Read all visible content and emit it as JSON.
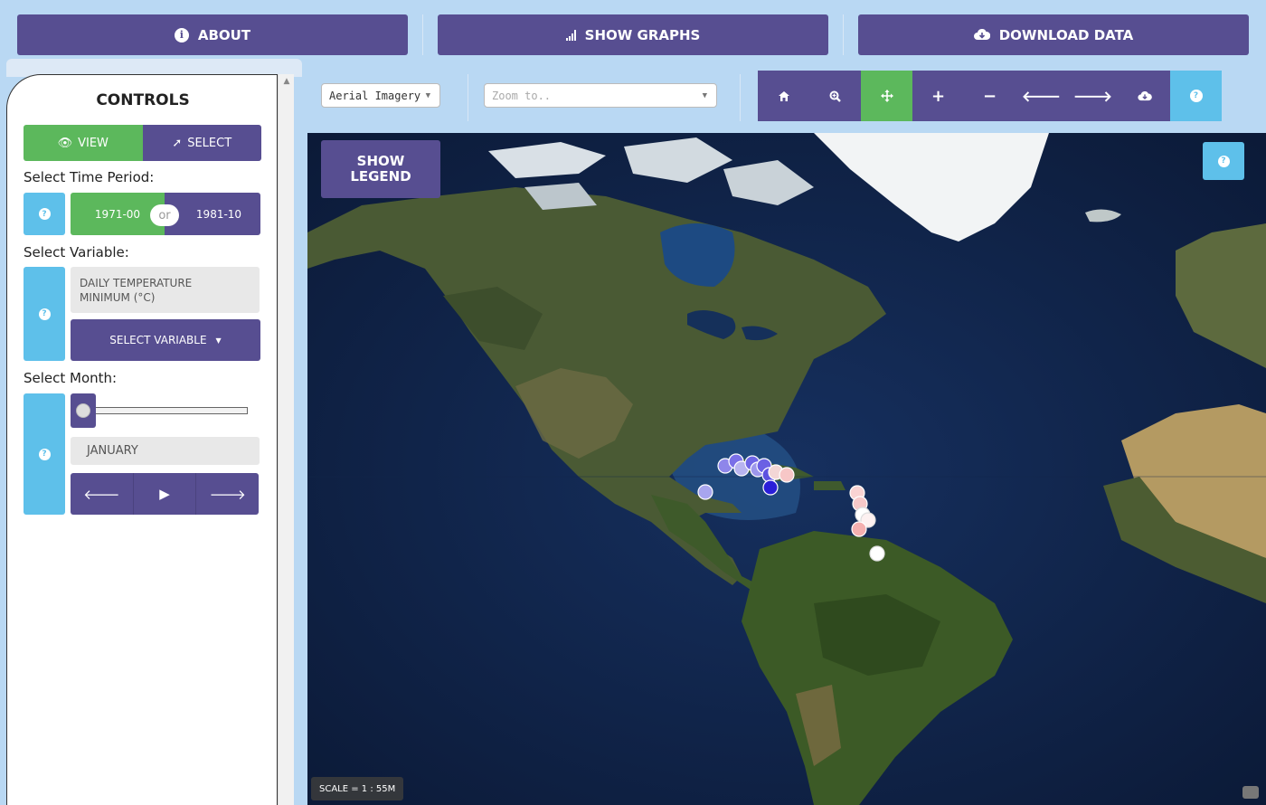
{
  "topbar": {
    "about_label": "ABOUT",
    "graphs_label": "SHOW GRAPHS",
    "download_label": "DOWNLOAD DATA"
  },
  "controls": {
    "title": "CONTROLS",
    "mode": {
      "view_label": "VIEW",
      "select_label": "SELECT",
      "active": "view"
    },
    "time_period": {
      "label": "Select Time Period:",
      "option_a": "1971-00",
      "or_text": "or",
      "option_b": "1981-10",
      "active": "1971-00"
    },
    "variable": {
      "label": "Select Variable:",
      "current_line1": "DAILY TEMPERATURE",
      "current_line2": "MINIMUM (°C)",
      "button_label": "SELECT VARIABLE"
    },
    "month": {
      "label": "Select Month:",
      "current": "JANUARY",
      "slider_value": 0
    }
  },
  "map_toolbar": {
    "basemap": "Aerial Imagery",
    "zoom_placeholder": "Zoom to..",
    "tools": [
      "home-icon",
      "zoom-extent-icon",
      "pan-icon",
      "zoom-in-icon",
      "zoom-out-icon",
      "back-icon",
      "forward-icon",
      "cloud-download-icon",
      "help-icon"
    ]
  },
  "map": {
    "legend_line1": "SHOW",
    "legend_line2": "LEGEND",
    "scale_text": "SCALE = 1 : 55M"
  },
  "colors": {
    "purple": "#574e91",
    "green": "#5cb85c",
    "blue": "#5ec0ea",
    "background": "#b9d8f3"
  }
}
